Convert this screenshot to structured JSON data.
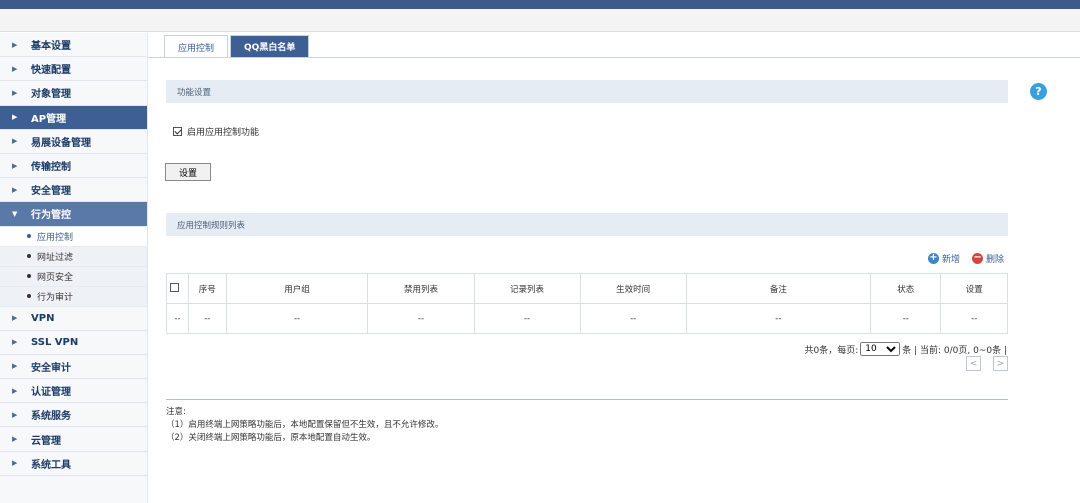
{
  "sidebar": {
    "items": [
      {
        "label": "基本设置"
      },
      {
        "label": "快速配置"
      },
      {
        "label": "对象管理"
      },
      {
        "label": "AP管理"
      },
      {
        "label": "易展设备管理"
      },
      {
        "label": "传输控制"
      },
      {
        "label": "安全管理"
      },
      {
        "label": "行为管控"
      },
      {
        "label": "VPN"
      },
      {
        "label": "SSL VPN"
      },
      {
        "label": "安全审计"
      },
      {
        "label": "认证管理"
      },
      {
        "label": "系统服务"
      },
      {
        "label": "云管理"
      },
      {
        "label": "系统工具"
      }
    ],
    "subitems": [
      {
        "label": "应用控制"
      },
      {
        "label": "网址过滤"
      },
      {
        "label": "网页安全"
      },
      {
        "label": "行为审计"
      }
    ]
  },
  "tabs": [
    {
      "label": "应用控制"
    },
    {
      "label": "QQ黑白名单"
    }
  ],
  "function_settings": {
    "title": "功能设置",
    "enable_label": "启用应用控制功能",
    "enabled": true,
    "set_button": "设置"
  },
  "rules": {
    "title": "应用控制规则列表",
    "add_label": "新增",
    "delete_label": "删除",
    "columns": [
      "序号",
      "用户组",
      "禁用列表",
      "记录列表",
      "生效时间",
      "备注",
      "状态",
      "设置"
    ],
    "empty_row": [
      "--",
      "--",
      "--",
      "--",
      "--",
      "--",
      "--",
      "--",
      "--"
    ]
  },
  "pager": {
    "total_prefix": "共0条，每页:",
    "per_page": "10",
    "per_page_options": [
      "10"
    ],
    "suffix": "条 | 当前: 0/0页, 0~0条 |",
    "prev": "<",
    "next": ">"
  },
  "notes": {
    "title": "注意:",
    "lines": [
      "（1）启用终端上网策略功能后，本地配置保留但不生效，且不允许修改。",
      "（2）关闭终端上网策略功能后，原本地配置自动生效。"
    ]
  },
  "help": "?",
  "colors": {
    "top_bar": "#3d5a8a",
    "active_nav": "#3d5f93",
    "help_icon": "#3aa0dc",
    "add_icon": "#3a86c8",
    "delete_icon": "#d6453b"
  }
}
